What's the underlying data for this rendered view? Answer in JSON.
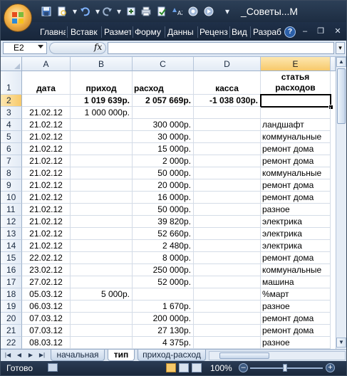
{
  "window": {
    "title": "_Советы...М",
    "accent": "#f4b54a"
  },
  "quick_access": [
    "save-icon",
    "print-preview-icon",
    "undo-icon",
    "redo-icon",
    "zoom-in-icon",
    "print-icon",
    "spell-icon",
    "sort-icon",
    "filter-icon",
    "recalc-icon"
  ],
  "ribbon_tabs": [
    "Главна",
    "Вставк",
    "Размет",
    "Форму",
    "Данны",
    "Реценз",
    "Вид",
    "Разраб"
  ],
  "formula_bar": {
    "name_box": "E2",
    "fx_label": "fx",
    "formula": ""
  },
  "columns": [
    "A",
    "B",
    "C",
    "D",
    "E"
  ],
  "selected_column": "E",
  "header_row": {
    "row": "1",
    "date": "дата",
    "income": "приход",
    "expense": "расход",
    "cash": "касса",
    "category": "статья расходов"
  },
  "totals_row": {
    "row": "2",
    "date": "",
    "income": "1 019 639р.",
    "expense": "2 057 669р.",
    "cash": "-1 038 030р.",
    "category": ""
  },
  "rows": [
    {
      "n": "3",
      "date": "21.02.12",
      "income": "1 000 000р.",
      "expense": "",
      "cash": "",
      "category": ""
    },
    {
      "n": "4",
      "date": "21.02.12",
      "income": "",
      "expense": "300 000р.",
      "cash": "",
      "category": "ландшафт"
    },
    {
      "n": "5",
      "date": "21.02.12",
      "income": "",
      "expense": "30 000р.",
      "cash": "",
      "category": "коммунальные"
    },
    {
      "n": "6",
      "date": "21.02.12",
      "income": "",
      "expense": "15 000р.",
      "cash": "",
      "category": "ремонт дома"
    },
    {
      "n": "7",
      "date": "21.02.12",
      "income": "",
      "expense": "2 000р.",
      "cash": "",
      "category": "ремонт дома"
    },
    {
      "n": "8",
      "date": "21.02.12",
      "income": "",
      "expense": "50 000р.",
      "cash": "",
      "category": "коммунальные"
    },
    {
      "n": "9",
      "date": "21.02.12",
      "income": "",
      "expense": "20 000р.",
      "cash": "",
      "category": "ремонт дома"
    },
    {
      "n": "10",
      "date": "21.02.12",
      "income": "",
      "expense": "16 000р.",
      "cash": "",
      "category": "ремонт дома"
    },
    {
      "n": "11",
      "date": "21.02.12",
      "income": "",
      "expense": "50 000р.",
      "cash": "",
      "category": "разное"
    },
    {
      "n": "12",
      "date": "21.02.12",
      "income": "",
      "expense": "39 820р.",
      "cash": "",
      "category": "электрика"
    },
    {
      "n": "13",
      "date": "21.02.12",
      "income": "",
      "expense": "52 660р.",
      "cash": "",
      "category": "электрика"
    },
    {
      "n": "14",
      "date": "21.02.12",
      "income": "",
      "expense": "2 480р.",
      "cash": "",
      "category": "электрика"
    },
    {
      "n": "15",
      "date": "22.02.12",
      "income": "",
      "expense": "8 000р.",
      "cash": "",
      "category": "ремонт дома"
    },
    {
      "n": "16",
      "date": "23.02.12",
      "income": "",
      "expense": "250 000р.",
      "cash": "",
      "category": "коммунальные"
    },
    {
      "n": "17",
      "date": "27.02.12",
      "income": "",
      "expense": "52 000р.",
      "cash": "",
      "category": "машина"
    },
    {
      "n": "18",
      "date": "05.03.12",
      "income": "5 000р.",
      "expense": "",
      "cash": "",
      "category": "%март"
    },
    {
      "n": "19",
      "date": "06.03.12",
      "income": "",
      "expense": "1 670р.",
      "cash": "",
      "category": "разное"
    },
    {
      "n": "20",
      "date": "07.03.12",
      "income": "",
      "expense": "200 000р.",
      "cash": "",
      "category": "ремонт дома"
    },
    {
      "n": "21",
      "date": "07.03.12",
      "income": "",
      "expense": "27 130р.",
      "cash": "",
      "category": "ремонт дома"
    },
    {
      "n": "22",
      "date": "08.03.12",
      "income": "",
      "expense": "4 375р.",
      "cash": "",
      "category": "разное"
    }
  ],
  "sheet_tabs": [
    {
      "label": "начальная",
      "active": false
    },
    {
      "label": "тип",
      "active": true
    },
    {
      "label": "приход-расход",
      "active": false
    }
  ],
  "status": {
    "text": "Готово",
    "zoom": "100%"
  }
}
